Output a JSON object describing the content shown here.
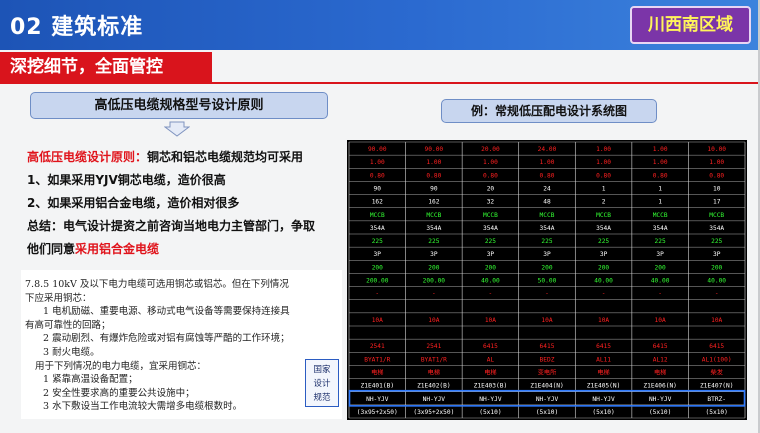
{
  "header": {
    "title": "02 建筑标准",
    "region_badge": "川西南区域"
  },
  "subheader": {
    "label": "深挖细节，全面管控"
  },
  "left_box": {
    "title": "高低压电缆规格型号设计原则"
  },
  "right_box": {
    "title": "例：常规低压配电设计系统图"
  },
  "principles": {
    "lead_red": "高低压电缆设计原则：",
    "lead_rest": "铜芯和铝芯电缆规范均可采用",
    "item1": "1、如果采用YJV铜芯电缆，造价很高",
    "item2": "2、如果采用铝合金电缆，造价相对很多",
    "summary_line1": "总结：电气设计提资之前咨询当地电力主管部门，争取",
    "summary_line2_prefix": "他们同意",
    "summary_line2_red": "采用铝合金电缆"
  },
  "code_excerpt": {
    "line1": "7.8.5   10kV 及以下电力电缆可选用铜芯或铝芯。但在下列情况",
    "line2": "下应采用铜芯：",
    "line3": "1   电机励磁、重要电源、移动式电气设备等需要保持连接具",
    "line4": "有高可靠性的回路；",
    "line5": "2   震动剧烈、有爆炸危险或对铝有腐蚀等严酷的工作环境；",
    "line6": "3   耐火电缆。",
    "line7": "用于下列情况的电力电缆，宜采用铜芯：",
    "line8": "1   紧靠高温设备配置；",
    "line9": "2   安全性要求高的重要公共设施中；",
    "line10": "3   水下敷设当工作电流较大需增多电缆根数时。",
    "badge_line1": "国家",
    "badge_line2": "设计",
    "badge_line3": "规范"
  },
  "cad_table": {
    "columns": 7,
    "rows": [
      {
        "color": "#ff2020",
        "cells": [
          "90.00",
          "90.00",
          "20.00",
          "24.00",
          "1.00",
          "1.00",
          "10.00"
        ]
      },
      {
        "color": "#ff2020",
        "cells": [
          "1.00",
          "1.00",
          "1.00",
          "1.00",
          "1.00",
          "1.00",
          "1.00"
        ]
      },
      {
        "color": "#ff2020",
        "cells": [
          "0.80",
          "0.80",
          "0.80",
          "0.80",
          "0.80",
          "0.80",
          "0.80"
        ]
      },
      {
        "color": "#ffffff",
        "cells": [
          "90",
          "90",
          "20",
          "24",
          "1",
          "1",
          "10"
        ]
      },
      {
        "color": "#ffffff",
        "cells": [
          "162",
          "162",
          "32",
          "48",
          "2",
          "1",
          "17"
        ]
      },
      {
        "color": "#33ff33",
        "cells": [
          "MCCB",
          "MCCB",
          "MCCB",
          "MCCB",
          "MCCB",
          "MCCB",
          "MCCB"
        ]
      },
      {
        "color": "#ffffff",
        "cells": [
          "354A",
          "354A",
          "354A",
          "354A",
          "354A",
          "354A",
          "354A"
        ]
      },
      {
        "color": "#33ff33",
        "cells": [
          "225",
          "225",
          "225",
          "225",
          "225",
          "225",
          "225"
        ]
      },
      {
        "color": "#ffffff",
        "cells": [
          "3P",
          "3P",
          "3P",
          "3P",
          "3P",
          "3P",
          "3P"
        ]
      },
      {
        "color": "#33ff33",
        "cells": [
          "200",
          "200",
          "200",
          "200",
          "200",
          "200",
          "200"
        ]
      },
      {
        "color": "#33ff33",
        "cells": [
          "200.00",
          "200.00",
          "40.00",
          "50.00",
          "40.00",
          "40.00",
          "40.00"
        ]
      },
      {
        "color": "#ff2020",
        "cells": [
          "-",
          "-",
          "-",
          "-",
          "-",
          "-",
          "-"
        ]
      },
      {
        "color": "#ff2020",
        "cells": [
          "",
          "",
          "",
          "",
          "",
          "",
          ""
        ]
      },
      {
        "color": "#ff2020",
        "cells": [
          "10A",
          "10A",
          "10A",
          "10A",
          "10A",
          "10A",
          "10A"
        ]
      },
      {
        "color": "#ff2020",
        "cells": [
          "",
          "",
          "",
          "",
          "",
          "",
          ""
        ]
      },
      {
        "color": "#ff2020",
        "cells": [
          "2541",
          "2541",
          "6415",
          "6415",
          "6415",
          "6415",
          "6415"
        ]
      },
      {
        "color": "#ff2020",
        "cells": [
          "BYAT1/R",
          "BYAT1/R",
          "AL",
          "BEDZ",
          "AL11",
          "AL12",
          "AL1(100)"
        ]
      },
      {
        "color": "#ff2020",
        "cells": [
          "电梯",
          "电梯",
          "电梯",
          "变电所",
          "电梯",
          "电梯",
          "柴发"
        ]
      },
      {
        "color": "#ffffff",
        "cells": [
          "Z1E401(B)",
          "Z1E402(B)",
          "Z1E403(B)",
          "Z1E404(N)",
          "Z1E405(N)",
          "Z1E406(N)",
          "Z1E407(N)"
        ]
      },
      {
        "color": "#ffffff",
        "cells": [
          "NH-YJV",
          "NH-YJV",
          "NH-YJV",
          "NH-YJV",
          "NH-YJV",
          "NH-YJV",
          "BTRZ-"
        ]
      },
      {
        "color": "#ffffff",
        "cells": [
          "(3x95+2x50)",
          "(3x95+2x50)",
          "(5x10)",
          "(5x10)",
          "(5x10)",
          "(5x10)",
          "(5x10)"
        ]
      }
    ],
    "highlight_row_index": 19,
    "highlight_color": "#2f7bff",
    "grid_color": "#d8d8d8"
  }
}
